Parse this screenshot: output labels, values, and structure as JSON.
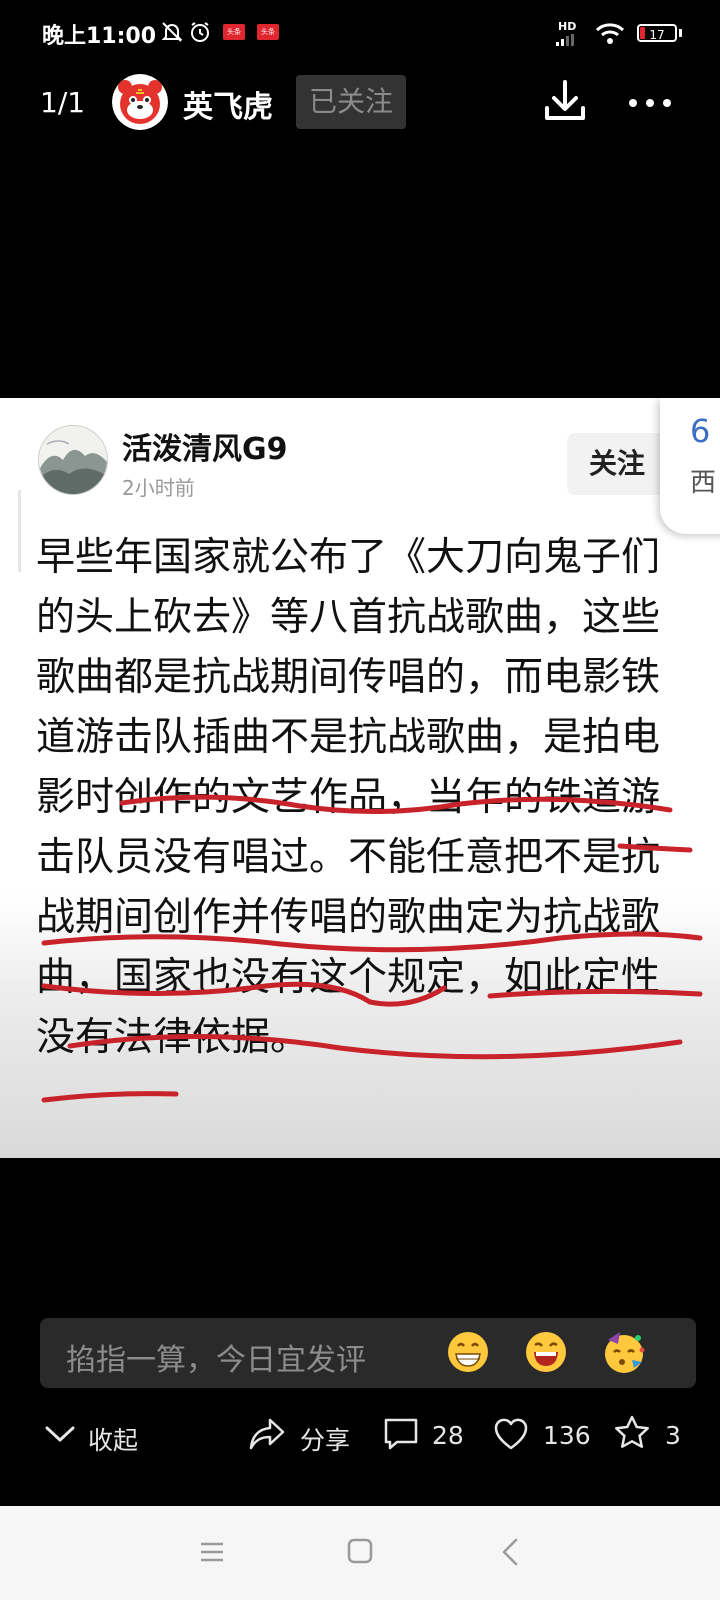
{
  "status_bar": {
    "time": "晚上11:00",
    "network": "HD",
    "battery": "17"
  },
  "top_bar": {
    "page_indicator": "1/1",
    "author_name": "英飞虎",
    "follow_state": "已关注"
  },
  "card": {
    "commenter_name": "活泼清风G9",
    "comment_time": "2小时前",
    "follow_label": "关注",
    "comment_text": "早些年国家就公布了《大刀向鬼子们的头上砍去》等八首抗战歌曲，这些歌曲都是抗战期间传唱的，而电影铁道游击队插曲不是抗战歌曲，是拍电影时创作的文艺作品，当年的铁道游击队员没有唱过。不能任意把不是抗战期间创作并传唱的歌曲定为抗战歌曲，国家也没有这个规定，如此定性没有法律依据。",
    "side_card_number": "6",
    "side_card_text": "西"
  },
  "comment_input": {
    "placeholder": "掐指一算，今日宜发评",
    "emojis": [
      "grinning-emoji",
      "laughing-emoji",
      "party-emoji"
    ]
  },
  "actions": {
    "collapse_label": "收起",
    "share_label": "分享",
    "comment_count": "28",
    "like_count": "136",
    "favorite_count": "3"
  },
  "colors": {
    "underline": "#c8222a",
    "accent_blue": "#3b6fc4",
    "news_red": "#e0262f"
  }
}
